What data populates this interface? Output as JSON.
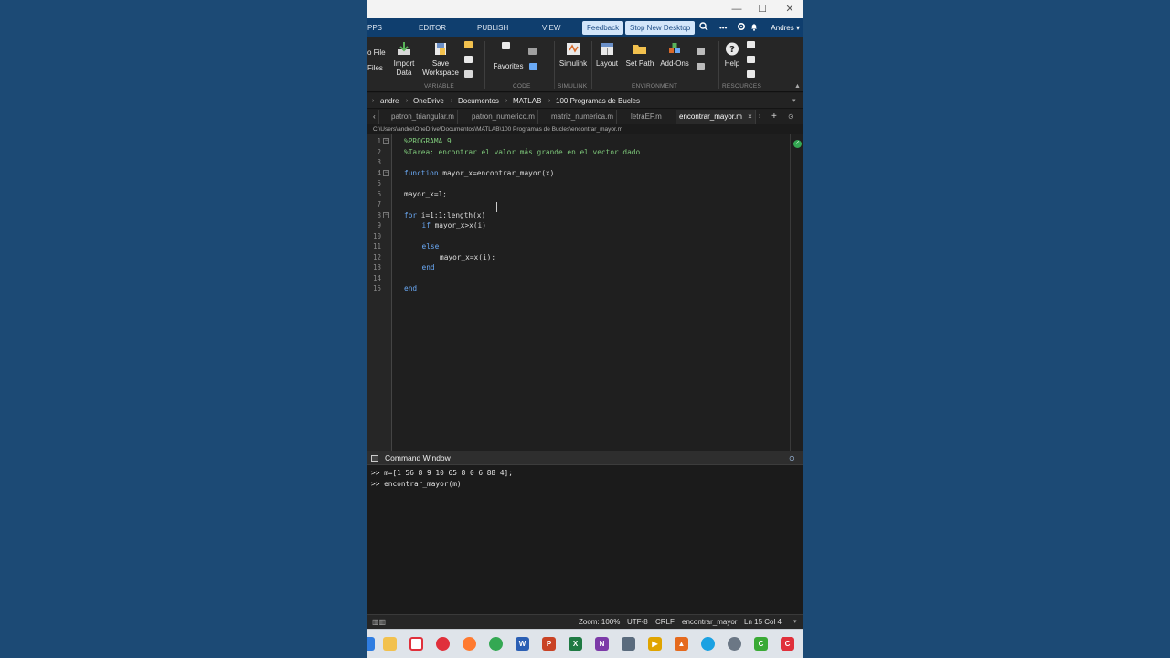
{
  "titlebar": {
    "minimize": "—",
    "maximize": "☐",
    "close": "✕"
  },
  "ribbon_tabs": {
    "apps": "PPS",
    "editor": "EDITOR",
    "publish": "PUBLISH",
    "view": "VIEW",
    "feedback": "Feedback",
    "stop_desktop": "Stop New Desktop",
    "more": "•••",
    "user": "Andres ▾"
  },
  "toolstrip": {
    "open_file": "o File",
    "files": "Files",
    "import_label1": "Import",
    "import_label2": "Data",
    "save_label1": "Save",
    "save_label2": "Workspace",
    "favorites": "Favorites",
    "simulink": "Simulink",
    "layout": "Layout",
    "set_path": "Set Path",
    "add_ons": "Add-Ons",
    "help": "Help",
    "groups": {
      "variable": "VARIABLE",
      "code": "CODE",
      "simulink": "SIMULINK",
      "environment": "ENVIRONMENT",
      "resources": "RESOURCES"
    }
  },
  "address": {
    "crumbs": [
      "andre",
      "OneDrive",
      "Documentos",
      "MATLAB",
      "100 Programas de Bucles"
    ]
  },
  "file_tabs": [
    "patron_triangular.m",
    "patron_numerico.m",
    "matriz_numerica.m",
    "letraEF.m",
    "encontrar_mayor.m"
  ],
  "file_path": "C:\\Users\\andre\\OneDrive\\Documentos\\MATLAB\\100 Programas de Bucles\\encontrar_mayor.m",
  "code": {
    "line_numbers": [
      "1",
      "2",
      "3",
      "4",
      "5",
      "6",
      "7",
      "8",
      "9",
      "10",
      "11",
      "12",
      "13",
      "14",
      "15"
    ],
    "l1": "%PROGRAMA 9",
    "l2": "%Tarea: encontrar el valor más grande en el vector dado",
    "l4_kw": "function",
    "l4_rest": " mayor_x=encontrar_mayor(x)",
    "l6": "mayor_x=1;",
    "l8_kw": "for",
    "l8_rest": " i=1:1:length(x)",
    "l9_kw": "if",
    "l9_rest": " mayor_x>x(i)",
    "l11_kw": "else",
    "l12": "mayor_x=x(i);",
    "l13_kw": "end",
    "l15_kw": "end"
  },
  "command_window": {
    "title": "Command Window",
    "line1": ">> m=[1 56 8 9 10 65 8 0 6 88 4];",
    "line2": ">> encontrar_mayor(m)"
  },
  "statusbar": {
    "zoom": "Zoom: 100%",
    "encoding": "UTF-8",
    "eol": "CRLF",
    "function": "encontrar_mayor",
    "position": "Ln 15 Col 4"
  },
  "colors": {
    "ribbon": "#0f3e6e",
    "comment": "#7ec87a",
    "keyword": "#6aa9f5",
    "desktop": "#1c4a75"
  }
}
